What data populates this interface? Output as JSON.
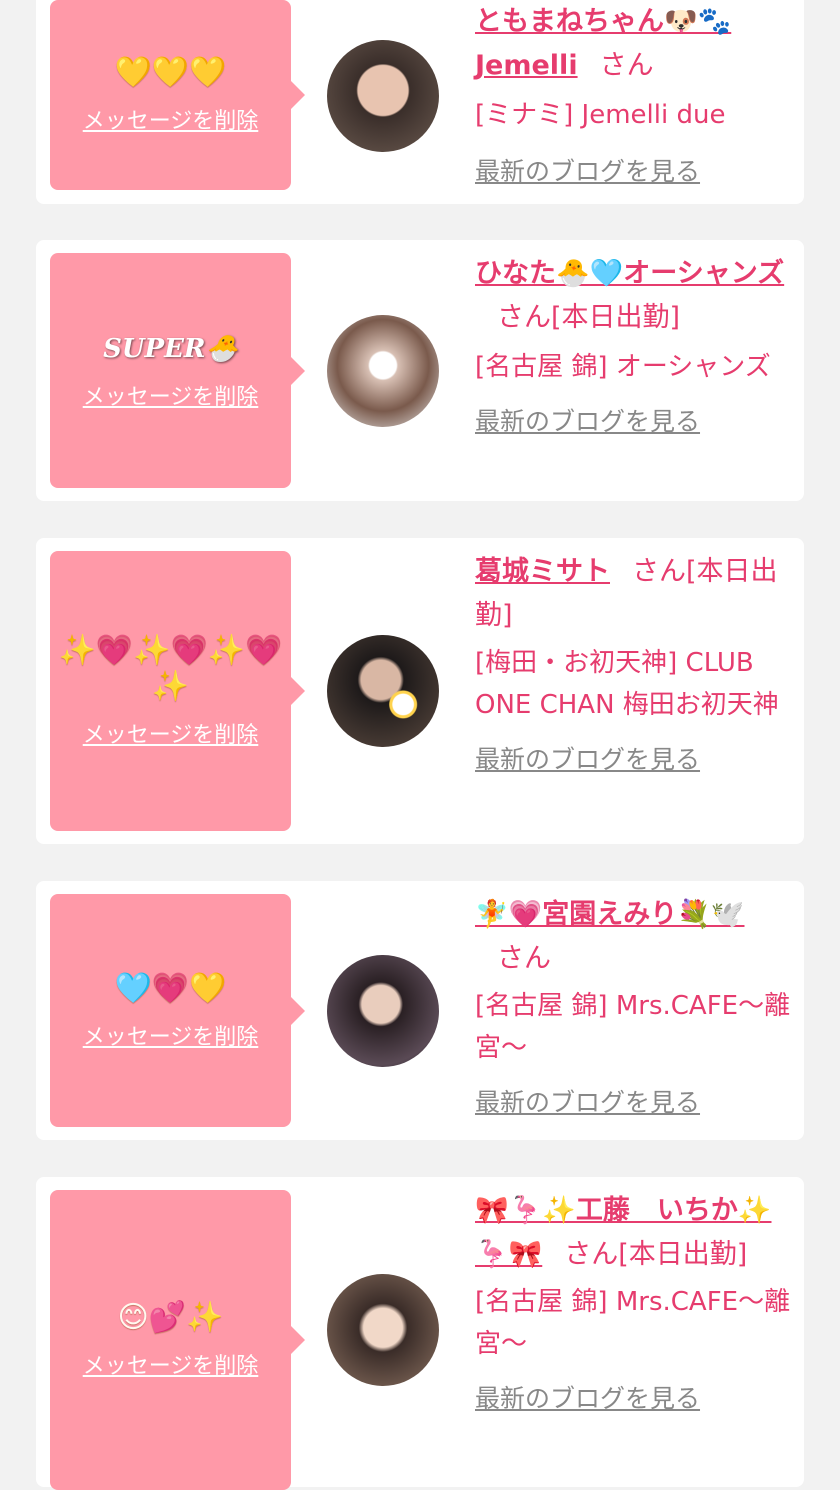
{
  "cards": [
    {
      "message": "💛💛💛",
      "delete_label": "メッセージを削除",
      "name": "ともまねちゃん🐶🐾Jemelli",
      "suffix": "さん",
      "shop": "[ミナミ] Jemelli due",
      "blog_label": "最新のブログを見る"
    },
    {
      "message": "SUPER🐣",
      "delete_label": "メッセージを削除",
      "name": "ひなた🐣🩵オーシャンズ",
      "suffix": "さん[本日出勤]",
      "shop": "[名古屋 錦] オーシャンズ",
      "blog_label": "最新のブログを見る"
    },
    {
      "message": "✨💗✨💗✨💗✨",
      "delete_label": "メッセージを削除",
      "name": "葛城ミサト",
      "suffix": "さん[本日出勤]",
      "shop": "[梅田・お初天神] CLUB ONE CHAN 梅田お初天神",
      "blog_label": "最新のブログを見る"
    },
    {
      "message": "🩵💗💛",
      "delete_label": "メッセージを削除",
      "name": "🧚💗宮園えみり💐🕊️",
      "suffix": "さん",
      "shop": "[名古屋 錦] Mrs.CAFE〜離宮〜",
      "blog_label": "最新のブログを見る"
    },
    {
      "message": "😊💕✨",
      "delete_label": "メッセージを削除",
      "name": "🎀🦩✨工藤　いちか✨🦩🎀",
      "suffix": "さん[本日出勤]",
      "shop": "[名古屋 錦] Mrs.CAFE〜離宮〜",
      "blog_label": "最新のブログを見る"
    }
  ],
  "colors": {
    "accent": "#e63c6e",
    "message_bg": "#ff99a8",
    "page_bg": "#f2f2f2",
    "card_bg": "#ffffff",
    "link_gray": "#888888"
  }
}
